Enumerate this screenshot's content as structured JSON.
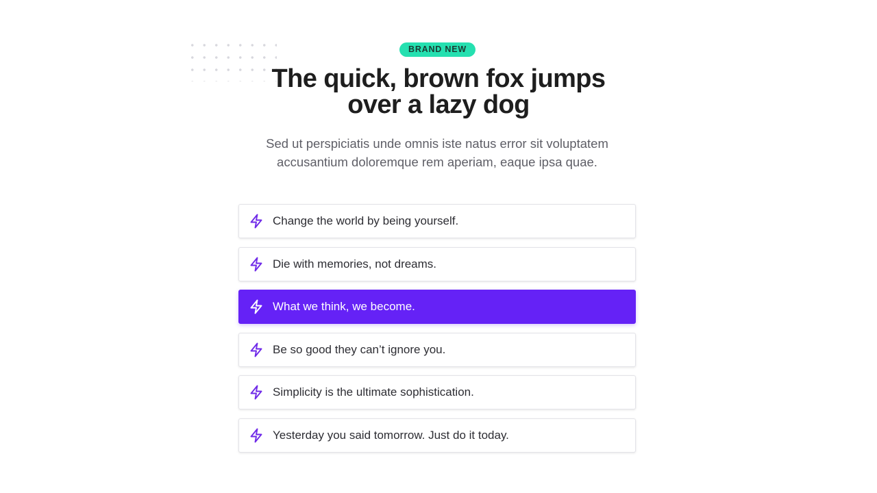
{
  "badge": "BRAND NEW",
  "headline": {
    "line1": "The quick, brown fox jumps",
    "line2": "over a lazy dog"
  },
  "subtitle": {
    "line1": "Sed ut perspiciatis unde omnis iste natus error sit voluptatem",
    "line2": "accusantium doloremque rem aperiam, eaque ipsa quae."
  },
  "items": [
    {
      "label": "Change the world by being yourself.",
      "icon": "lightning-icon",
      "active": false
    },
    {
      "label": "Die with memories, not dreams.",
      "icon": "lightning-icon",
      "active": false
    },
    {
      "label": "What we think, we become.",
      "icon": "lightning-icon",
      "active": true
    },
    {
      "label": "Be so good they can’t ignore you.",
      "icon": "lightning-icon",
      "active": false
    },
    {
      "label": "Simplicity is the ultimate sophistication.",
      "icon": "lightning-icon",
      "active": false
    },
    {
      "label": "Yesterday you said tomorrow. Just do it today.",
      "icon": "lightning-icon",
      "active": false
    }
  ],
  "colors": {
    "badge_bg": "#25e0b0",
    "accent": "#6522f6",
    "icon": "#6f2ae8",
    "heading": "#1e1e1e",
    "body_text": "#5e5e66"
  }
}
